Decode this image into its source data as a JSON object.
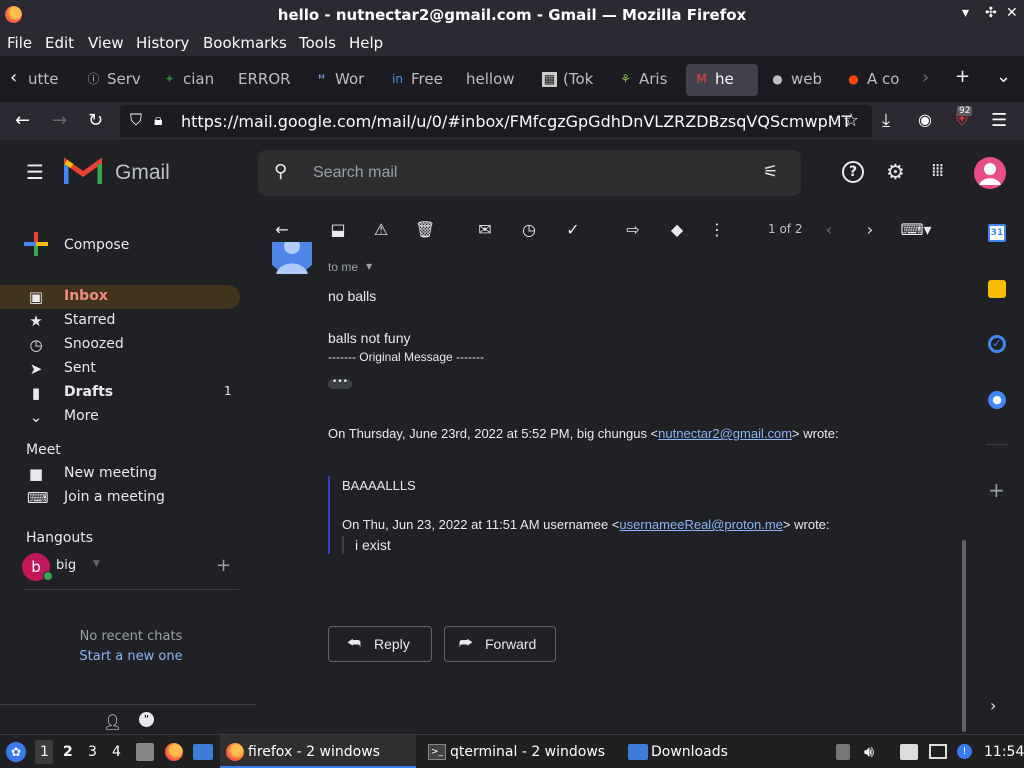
{
  "window": {
    "title": "hello - nutnectar2@gmail.com - Gmail — Mozilla Firefox"
  },
  "menu": [
    "File",
    "Edit",
    "View",
    "History",
    "Bookmarks",
    "Tools",
    "Help"
  ],
  "tabs": [
    {
      "label": "utte",
      "icon": "page-icon"
    },
    {
      "label": "Serv",
      "icon": "info-icon"
    },
    {
      "label": "cian",
      "icon": "leaf-icon"
    },
    {
      "label": "ERROR",
      "icon": "blank-icon"
    },
    {
      "label": "Wor",
      "icon": "wordpress-icon"
    },
    {
      "label": "Free",
      "icon": "indeed-icon"
    },
    {
      "label": "hellow",
      "icon": "blank-icon"
    },
    {
      "label": "(Tok",
      "icon": "grid-icon"
    },
    {
      "label": "Aris",
      "icon": "figure-icon"
    },
    {
      "label": "he",
      "icon": "gmail-icon"
    },
    {
      "label": "web",
      "icon": "github-icon"
    },
    {
      "label": "A co",
      "icon": "reddit-icon"
    }
  ],
  "address": {
    "url": "https://mail.google.com/mail/u/0/#inbox/FMfcgzGpGdhDnVLZRZDBzsqVQScmwpMT",
    "badge": "92"
  },
  "gmail": {
    "logo_text": "Gmail",
    "search_placeholder": "Search mail",
    "compose": "Compose",
    "nav": [
      {
        "label": "Inbox",
        "icon": "inbox-icon",
        "count": ""
      },
      {
        "label": "Starred",
        "icon": "star-icon",
        "count": ""
      },
      {
        "label": "Snoozed",
        "icon": "clock-icon",
        "count": ""
      },
      {
        "label": "Sent",
        "icon": "send-icon",
        "count": ""
      },
      {
        "label": "Drafts",
        "icon": "draft-icon",
        "count": "1"
      },
      {
        "label": "More",
        "icon": "chevron-down-icon",
        "count": ""
      }
    ],
    "meet": {
      "heading": "Meet",
      "new_meeting": "New meeting",
      "join": "Join a meeting"
    },
    "hangouts": {
      "heading": "Hangouts",
      "contact": "big",
      "avatar_letter": "b",
      "empty": "No recent chats",
      "start": "Start a new one"
    },
    "pager": "1 of 2",
    "avatar_letter": ""
  },
  "email": {
    "to_me": "to me",
    "line1": "no balls",
    "line2": "balls not funy",
    "original": "------- Original Message -------",
    "quote_header_pre": "On Thursday, June 23rd, 2022 at 5:52 PM, big chungus <",
    "quote_email": "nutnectar2@gmail.com",
    "quote_header_post": "> wrote:",
    "quote_body": "BAAAALLLS",
    "inner_header_pre": "On Thu, Jun 23, 2022 at 11:51 AM usernamee <",
    "inner_email": "usernameeReal@proton.me",
    "inner_header_post": "> wrote:",
    "inner_body": "i exist",
    "reply": "Reply",
    "forward": "Forward"
  },
  "taskbar": {
    "workspaces": [
      "1",
      "2",
      "3",
      "4"
    ],
    "apps": [
      "firefox - 2 windows",
      "qterminal - 2 windows",
      "Downloads"
    ],
    "clock": "11:54"
  },
  "colors": {
    "accent_red": "#f28b82",
    "link": "#8ab4f8",
    "selected_bg": "#41331c"
  }
}
